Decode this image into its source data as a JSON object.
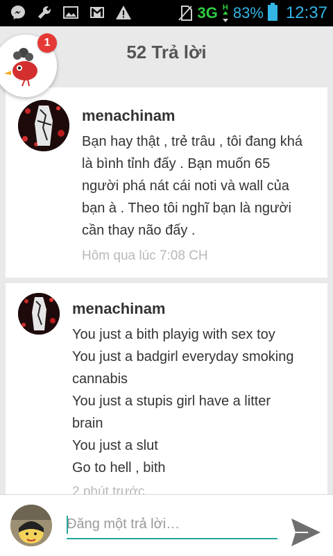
{
  "status_bar": {
    "network": "3G",
    "network_sub": "H",
    "battery_percent": "83%",
    "time": "12:37",
    "icons": [
      "messenger-icon",
      "wrench-icon",
      "image-icon",
      "gmail-icon",
      "warning-icon",
      "no-sim-icon",
      "signal-icon",
      "battery-icon"
    ],
    "accent": "#33b5e5"
  },
  "header": {
    "title": "52 Trả lời",
    "notification_count": "1"
  },
  "comments": [
    {
      "author": "menachinam",
      "lines": [
        "Bạn hay thật , trẻ trâu , tôi đang khá",
        "là bình tỉnh đấy . Bạn muốn 65",
        "người phá nát cái noti và wall của",
        "bạn à . Theo tôi nghĩ bạn là người",
        "cần thay não đấy ."
      ],
      "time": "Hôm qua lúc 7:08 CH"
    },
    {
      "author": "menachinam",
      "lines": [
        "You just a bith playig with sex toy",
        "You just a badgirl everyday smoking",
        "cannabis",
        "You just a stupis girl have a litter",
        "brain",
        "You just a slut",
        "Go to hell , bith"
      ],
      "time": "2 phút trước"
    }
  ],
  "reply": {
    "placeholder": "Đăng một trả lời…",
    "value": ""
  },
  "colors": {
    "input_underline": "#26a69a",
    "badge": "#e53935",
    "background": "#e9e9e9"
  }
}
